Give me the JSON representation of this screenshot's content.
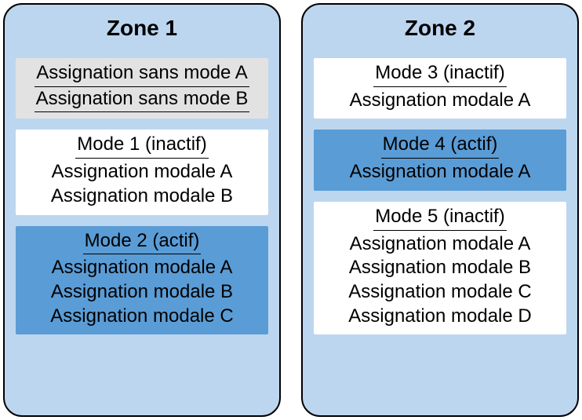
{
  "zones": [
    {
      "title": "Zone 1",
      "blocks": [
        {
          "kind": "modeless",
          "assignments": [
            "Assignation sans mode A",
            "Assignation sans mode B"
          ]
        },
        {
          "kind": "inactive",
          "header": "Mode 1 (inactif)",
          "assignments": [
            "Assignation modale A",
            "Assignation modale B"
          ]
        },
        {
          "kind": "active",
          "header": "Mode 2 (actif)",
          "assignments": [
            "Assignation modale A",
            "Assignation modale B",
            "Assignation modale C"
          ]
        }
      ]
    },
    {
      "title": "Zone 2",
      "blocks": [
        {
          "kind": "inactive",
          "header": "Mode 3 (inactif)",
          "assignments": [
            "Assignation modale A"
          ]
        },
        {
          "kind": "active",
          "header": "Mode 4 (actif)",
          "assignments": [
            "Assignation modale A"
          ]
        },
        {
          "kind": "inactive",
          "header": "Mode 5 (inactif)",
          "assignments": [
            "Assignation modale A",
            "Assignation modale B",
            "Assignation modale C",
            "Assignation modale D"
          ]
        }
      ]
    }
  ]
}
